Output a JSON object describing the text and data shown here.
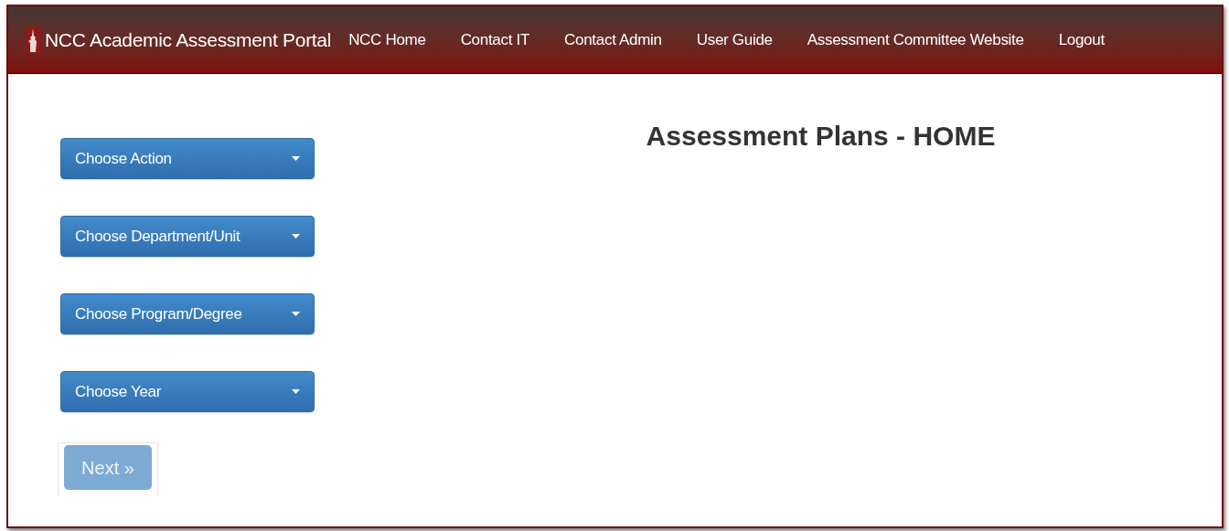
{
  "navbar": {
    "brand": "NCC Academic Assessment Portal",
    "links": [
      "NCC Home",
      "Contact IT",
      "Contact Admin",
      "User Guide",
      "Assessment Committee Website",
      "Logout"
    ]
  },
  "dropdowns": [
    {
      "label": "Choose Action"
    },
    {
      "label": "Choose Department/Unit"
    },
    {
      "label": "Choose Program/Degree"
    },
    {
      "label": "Choose Year"
    }
  ],
  "next_button": {
    "label": "Next »",
    "disabled": true
  },
  "heading": "Assessment Plans - HOME"
}
